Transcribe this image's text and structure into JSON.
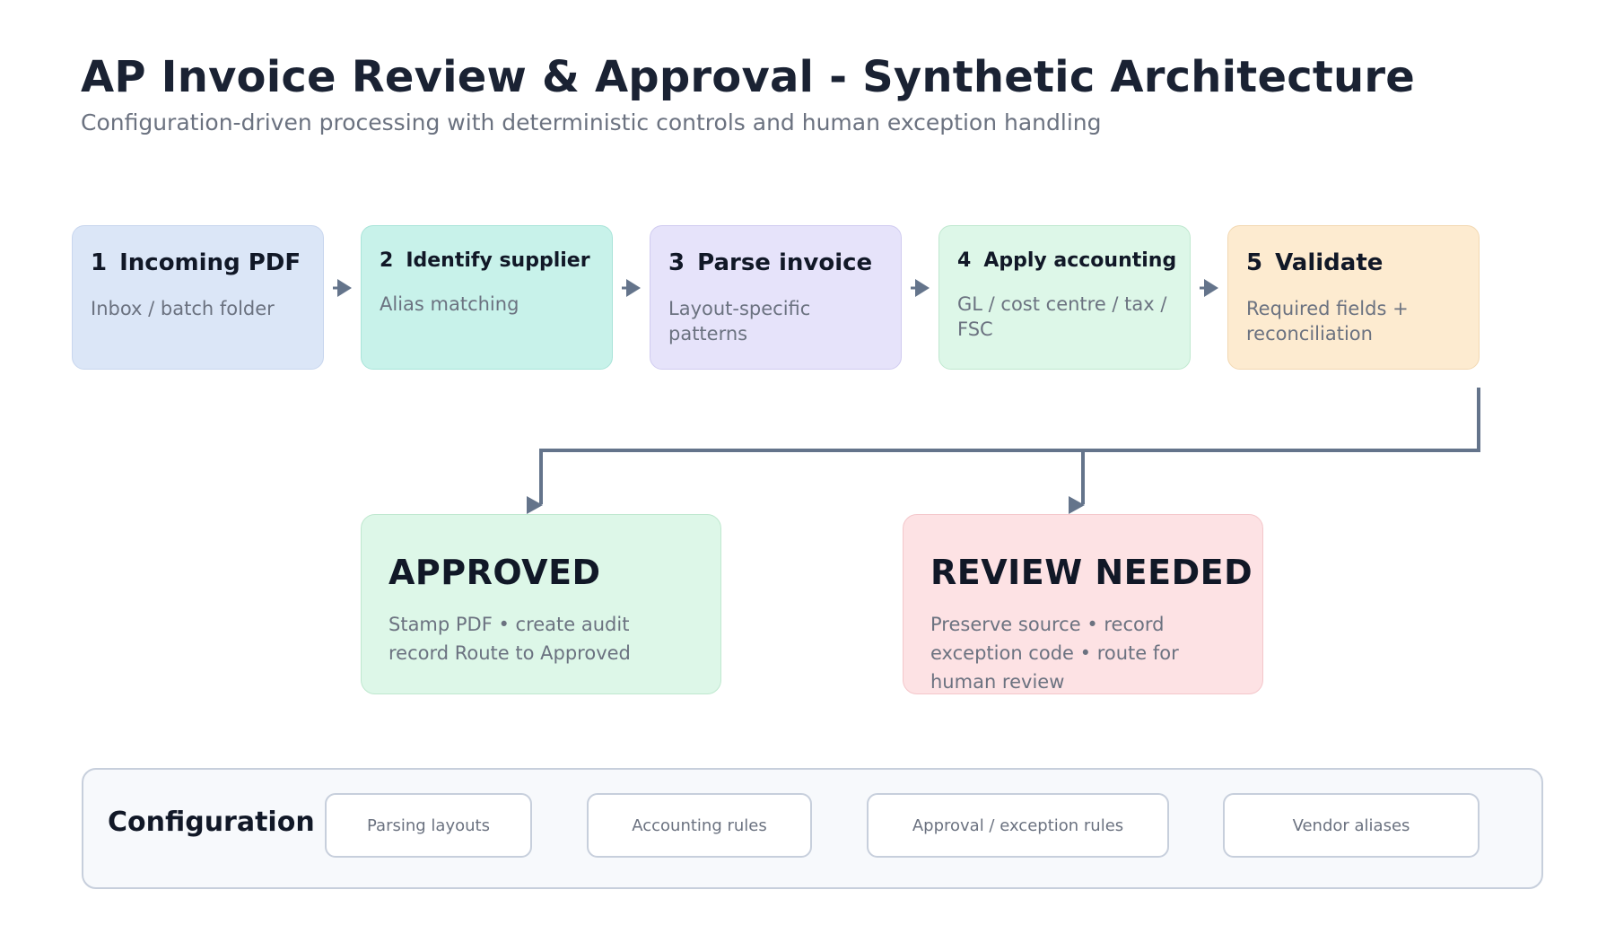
{
  "header": {
    "title": "AP Invoice Review & Approval - Synthetic Architecture",
    "subtitle": "Configuration-driven processing with deterministic controls and human exception handling"
  },
  "pipeline": {
    "steps": [
      {
        "num": "1",
        "title": "Incoming PDF",
        "desc": "Inbox / batch folder"
      },
      {
        "num": "2",
        "title": "Identify supplier",
        "desc": "Alias matching"
      },
      {
        "num": "3",
        "title": "Parse invoice",
        "desc": "Layout-specific patterns"
      },
      {
        "num": "4",
        "title": "Apply accounting",
        "desc": "GL / cost centre / tax / FSC"
      },
      {
        "num": "5",
        "title": "Validate",
        "desc": "Required fields + reconciliation"
      }
    ]
  },
  "outcomes": {
    "approved": {
      "title": "APPROVED",
      "desc": "Stamp PDF • create audit record Route to Approved"
    },
    "review": {
      "title": "REVIEW NEEDED",
      "desc": "Preserve source • record exception code • route for human review"
    }
  },
  "configuration": {
    "label": "Configuration",
    "items": [
      "Parsing layouts",
      "Accounting rules",
      "Approval / exception rules",
      "Vendor aliases"
    ]
  },
  "colors": {
    "step1": "#dbe6f7",
    "step2": "#c8f2ea",
    "step3": "#e6e3fa",
    "step4": "#ddf7e8",
    "step5": "#fdebd0",
    "approved": "#ddf7e8",
    "review": "#fde2e4",
    "connector": "#64748b"
  }
}
